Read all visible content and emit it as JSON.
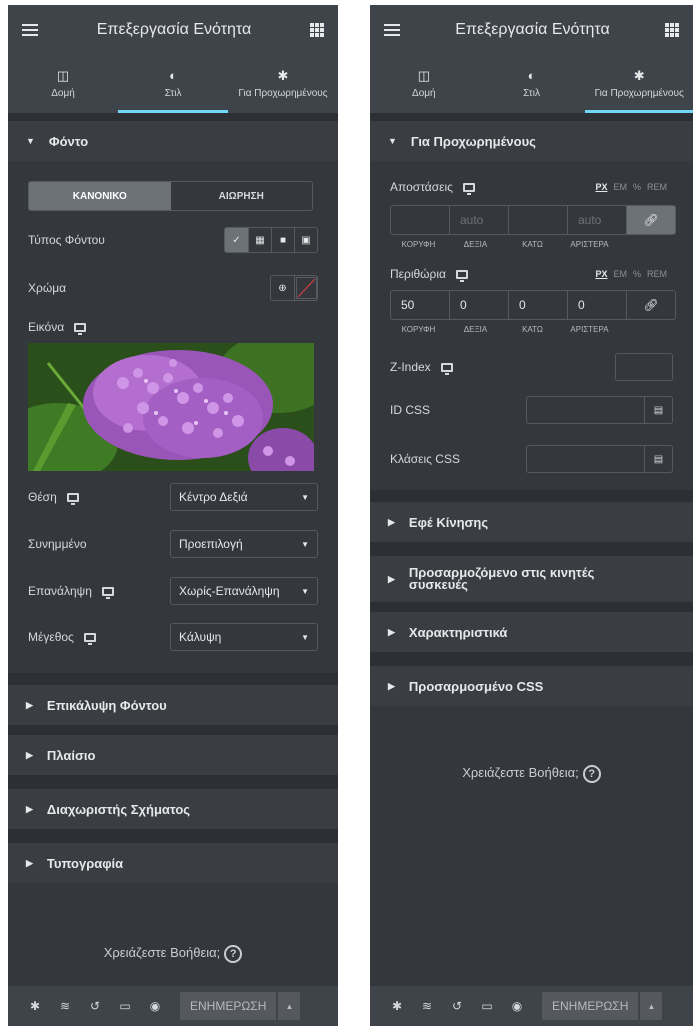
{
  "common": {
    "title": "Επεξεργασία Ενότητα",
    "tabs": [
      {
        "label": "Δομή",
        "icon": "columns-icon"
      },
      {
        "label": "Στιλ",
        "icon": "half-circle-icon"
      },
      {
        "label": "Για Προχωρημένους",
        "icon": "gear-icon"
      }
    ],
    "help_text": "Χρειάζεστε Βοήθεια;",
    "update_label": "ΕΝΗΜΕΡΩΣΗ",
    "accent_color": "#71d7f7"
  },
  "left": {
    "active_tab": "Στιλ",
    "background_section": "Φόντο",
    "state_tabs": [
      "ΚΑΝΟΝΙΚΟ",
      "ΑΙΩΡΗΣΗ"
    ],
    "background_type_label": "Τύπος Φόντου",
    "color_label": "Χρώμα",
    "image_label": "Εικόνα",
    "position": {
      "label": "Θέση",
      "value": "Κέντρο Δεξιά"
    },
    "attachment": {
      "label": "Συνημμένο",
      "value": "Προεπιλογή"
    },
    "repeat": {
      "label": "Επανάληψη",
      "value": "Χωρίς-Επανάληψη"
    },
    "size": {
      "label": "Μέγεθος",
      "value": "Κάλυψη"
    },
    "sections": [
      "Επικάλυψη Φόντου",
      "Πλαίσιο",
      "Διαχωριστής Σχήματος",
      "Τυπογραφία"
    ]
  },
  "right": {
    "active_tab": "Για Προχωρημένους",
    "advanced_section": "Για Προχωρημένους",
    "margin": {
      "label": "Αποστάσεις",
      "units": [
        "PX",
        "EM",
        "%",
        "REM"
      ],
      "placeholder": "auto",
      "values": [
        "",
        "auto",
        "",
        "auto"
      ]
    },
    "padding": {
      "label": "Περιθώρια",
      "units": [
        "PX",
        "EM",
        "%",
        "REM"
      ],
      "values": [
        "50",
        "0",
        "0",
        "0"
      ]
    },
    "dim_labels": [
      "ΚΟΡΥΦΗ",
      "ΔΕΞΙΑ",
      "ΚΑΤΩ",
      "ΑΡΙΣΤΕΡΑ"
    ],
    "zindex_label": "Z-Index",
    "css_id_label": "ID CSS",
    "css_classes_label": "Κλάσεις CSS",
    "sections": [
      "Εφέ Κίνησης",
      "Προσαρμοζόμενο στις κινητές συσκευές",
      "Χαρακτηριστικά",
      "Προσαρμοσμένο CSS"
    ]
  }
}
